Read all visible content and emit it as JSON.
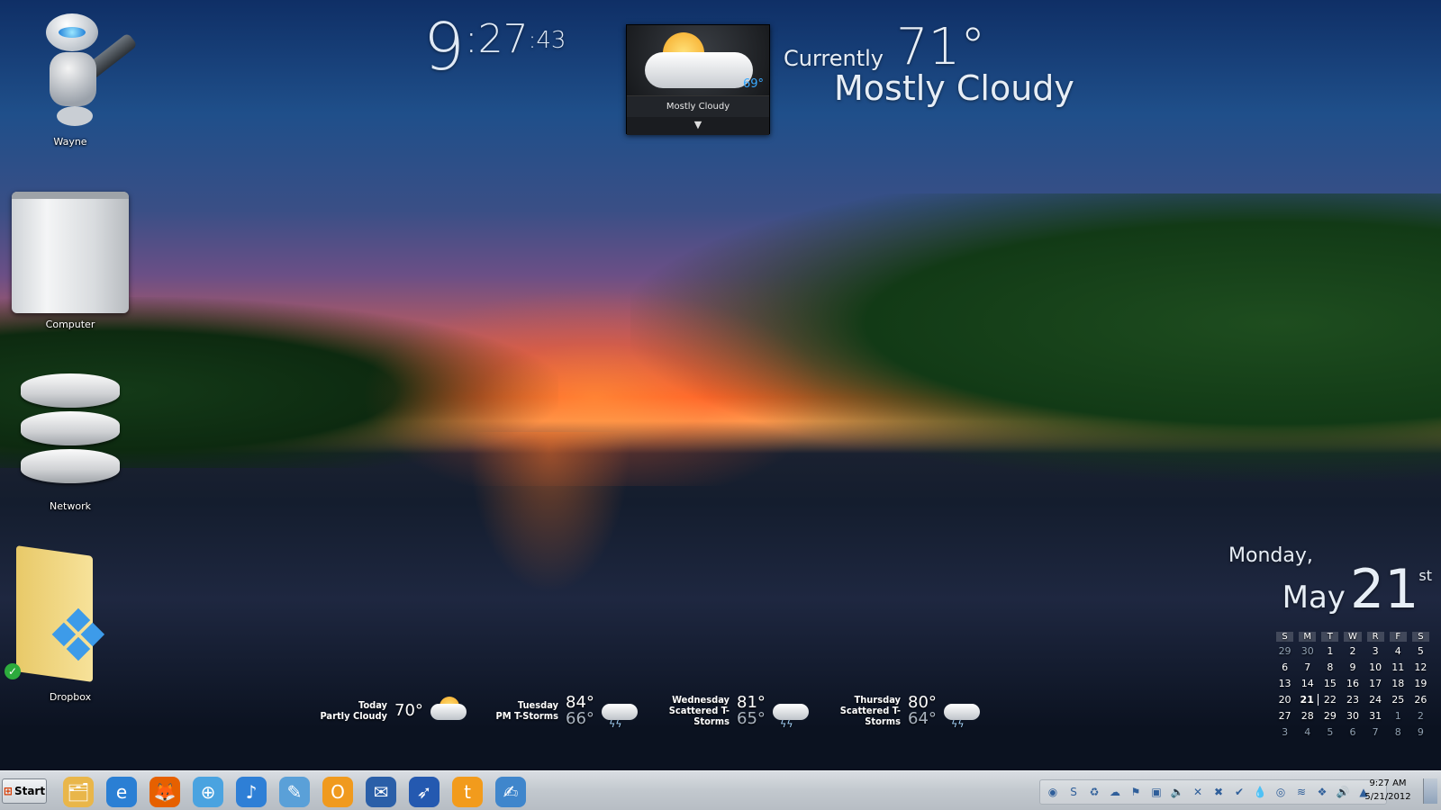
{
  "desktop_icons": [
    {
      "label": "Wayne",
      "icon": "automator-robot-icon"
    },
    {
      "label": "Computer",
      "icon": "mac-pro-icon"
    },
    {
      "label": "Network",
      "icon": "network-drives-icon"
    },
    {
      "label": "Dropbox",
      "icon": "dropbox-folder-icon"
    }
  ],
  "clock": {
    "hour": "9",
    "minute": ":27",
    "second": ":43"
  },
  "weather_gadget": {
    "temp": "69°",
    "condition": "Mostly Cloudy",
    "expand_glyph": "▼"
  },
  "current_weather": {
    "label": "Currently",
    "temp": "71°",
    "condition": "Mostly Cloudy"
  },
  "forecast": [
    {
      "day": "Today",
      "condition": "Partly Cloudy",
      "high": "70°",
      "low": "",
      "icon": "partly-cloudy-icon"
    },
    {
      "day": "Tuesday",
      "condition": "PM T-Storms",
      "high": "84°",
      "low": "66°",
      "icon": "thunderstorm-icon"
    },
    {
      "day": "Wednesday",
      "condition": "Scattered T-Storms",
      "high": "81°",
      "low": "65°",
      "icon": "thunderstorm-icon"
    },
    {
      "day": "Thursday",
      "condition": "Scattered T-Storms",
      "high": "80°",
      "low": "64°",
      "icon": "thunderstorm-icon"
    }
  ],
  "date_widget": {
    "weekday": "Monday,",
    "month": "May",
    "day": "21",
    "suffix": "st"
  },
  "calendar": {
    "headers": [
      "S",
      "M",
      "T",
      "W",
      "R",
      "F",
      "S"
    ],
    "today": "21",
    "weeks": [
      [
        "29",
        "30",
        "1",
        "2",
        "3",
        "4",
        "5"
      ],
      [
        "6",
        "7",
        "8",
        "9",
        "10",
        "11",
        "12"
      ],
      [
        "13",
        "14",
        "15",
        "16",
        "17",
        "18",
        "19"
      ],
      [
        "20",
        "21",
        "22",
        "23",
        "24",
        "25",
        "26"
      ],
      [
        "27",
        "28",
        "29",
        "30",
        "31",
        "1",
        "2"
      ],
      [
        "3",
        "4",
        "5",
        "6",
        "7",
        "8",
        "9"
      ]
    ],
    "dim_first": [
      "29",
      "30"
    ],
    "dim_last_rows": [
      4,
      5
    ]
  },
  "taskbar": {
    "start_label": "Start",
    "quick_launch": [
      {
        "icon": "file-explorer-icon",
        "glyph": "🗂",
        "color": "#e9b64a"
      },
      {
        "icon": "internet-explorer-icon",
        "glyph": "e",
        "color": "#2a7fd4"
      },
      {
        "icon": "firefox-icon",
        "glyph": "🦊",
        "color": "#e66000"
      },
      {
        "icon": "safari-icon",
        "glyph": "⊕",
        "color": "#4aa3e0"
      },
      {
        "icon": "itunes-icon",
        "glyph": "♪",
        "color": "#2e7fd6"
      },
      {
        "icon": "notepad-icon",
        "glyph": "✎",
        "color": "#5aa0d8"
      },
      {
        "icon": "outlook-icon",
        "glyph": "O",
        "color": "#f09a1e"
      },
      {
        "icon": "thunderbird-icon",
        "glyph": "✉",
        "color": "#2a5fa8"
      },
      {
        "icon": "rocket-app-icon",
        "glyph": "➶",
        "color": "#2459b0"
      },
      {
        "icon": "tumblr-icon",
        "glyph": "t",
        "color": "#f29b1c"
      },
      {
        "icon": "edit-notes-icon",
        "glyph": "✍",
        "color": "#3f86cc"
      }
    ],
    "tray_icons": [
      {
        "icon": "globe-tray-icon",
        "glyph": "◉"
      },
      {
        "icon": "skype-tray-icon",
        "glyph": "S"
      },
      {
        "icon": "recycle-tray-icon",
        "glyph": "♻"
      },
      {
        "icon": "cloud-tray-icon",
        "glyph": "☁"
      },
      {
        "icon": "flag-tray-icon",
        "glyph": "⚑"
      },
      {
        "icon": "monitor-tray-icon",
        "glyph": "▣"
      },
      {
        "icon": "volume-tray-icon",
        "glyph": "🔈"
      },
      {
        "icon": "shuffle-tray-icon",
        "glyph": "✕"
      },
      {
        "icon": "cross-tray-icon",
        "glyph": "✖"
      },
      {
        "icon": "check-tray-icon",
        "glyph": "✔"
      },
      {
        "icon": "drop-tray-icon",
        "glyph": "💧"
      },
      {
        "icon": "chrome-tray-icon",
        "glyph": "◎"
      },
      {
        "icon": "network-tray-icon",
        "glyph": "≋"
      },
      {
        "icon": "dropbox-tray-icon",
        "glyph": "❖"
      },
      {
        "icon": "speaker-tray-icon",
        "glyph": "🔊"
      },
      {
        "icon": "drive-tray-icon",
        "glyph": "▲"
      }
    ],
    "time": "9:27 AM",
    "date": "5/21/2012"
  }
}
